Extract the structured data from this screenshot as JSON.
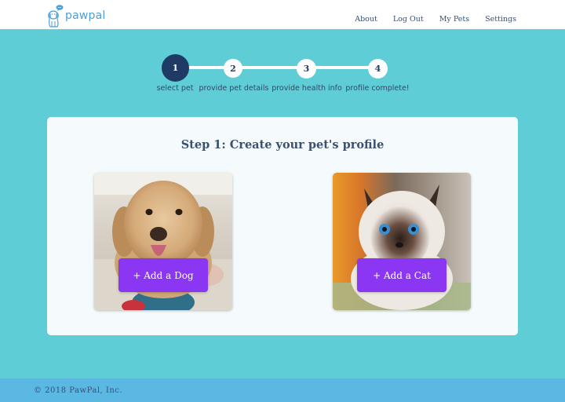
{
  "header": {
    "logo_text": "pawpal",
    "logo_icon": "dog-with-speech-bubble-icon",
    "nav": [
      {
        "label": "About"
      },
      {
        "label": "Log Out"
      },
      {
        "label": "My Pets"
      },
      {
        "label": "Settings"
      }
    ]
  },
  "stepper": {
    "current_step": 1,
    "steps": [
      {
        "number": "1",
        "label": "select pet",
        "active": true
      },
      {
        "number": "2",
        "label": "provide pet details",
        "active": false
      },
      {
        "number": "3",
        "label": "provide health info",
        "active": false
      },
      {
        "number": "4",
        "label": "profile complete!",
        "active": false
      }
    ]
  },
  "main": {
    "title": "Step 1: Create your pet's profile",
    "options": [
      {
        "pet": "dog",
        "image": "dog-photo",
        "button_label": "+ Add a Dog"
      },
      {
        "pet": "cat",
        "image": "cat-photo",
        "button_label": "+ Add a Cat"
      }
    ]
  },
  "footer": {
    "copyright": "© 2018 PawPal, Inc."
  },
  "colors": {
    "page_bg": "#5fcdd5",
    "active_step": "#1f3a64",
    "button": "#8b36f3",
    "footer_bg": "#5ab8e2",
    "logo": "#4a9fd8"
  }
}
